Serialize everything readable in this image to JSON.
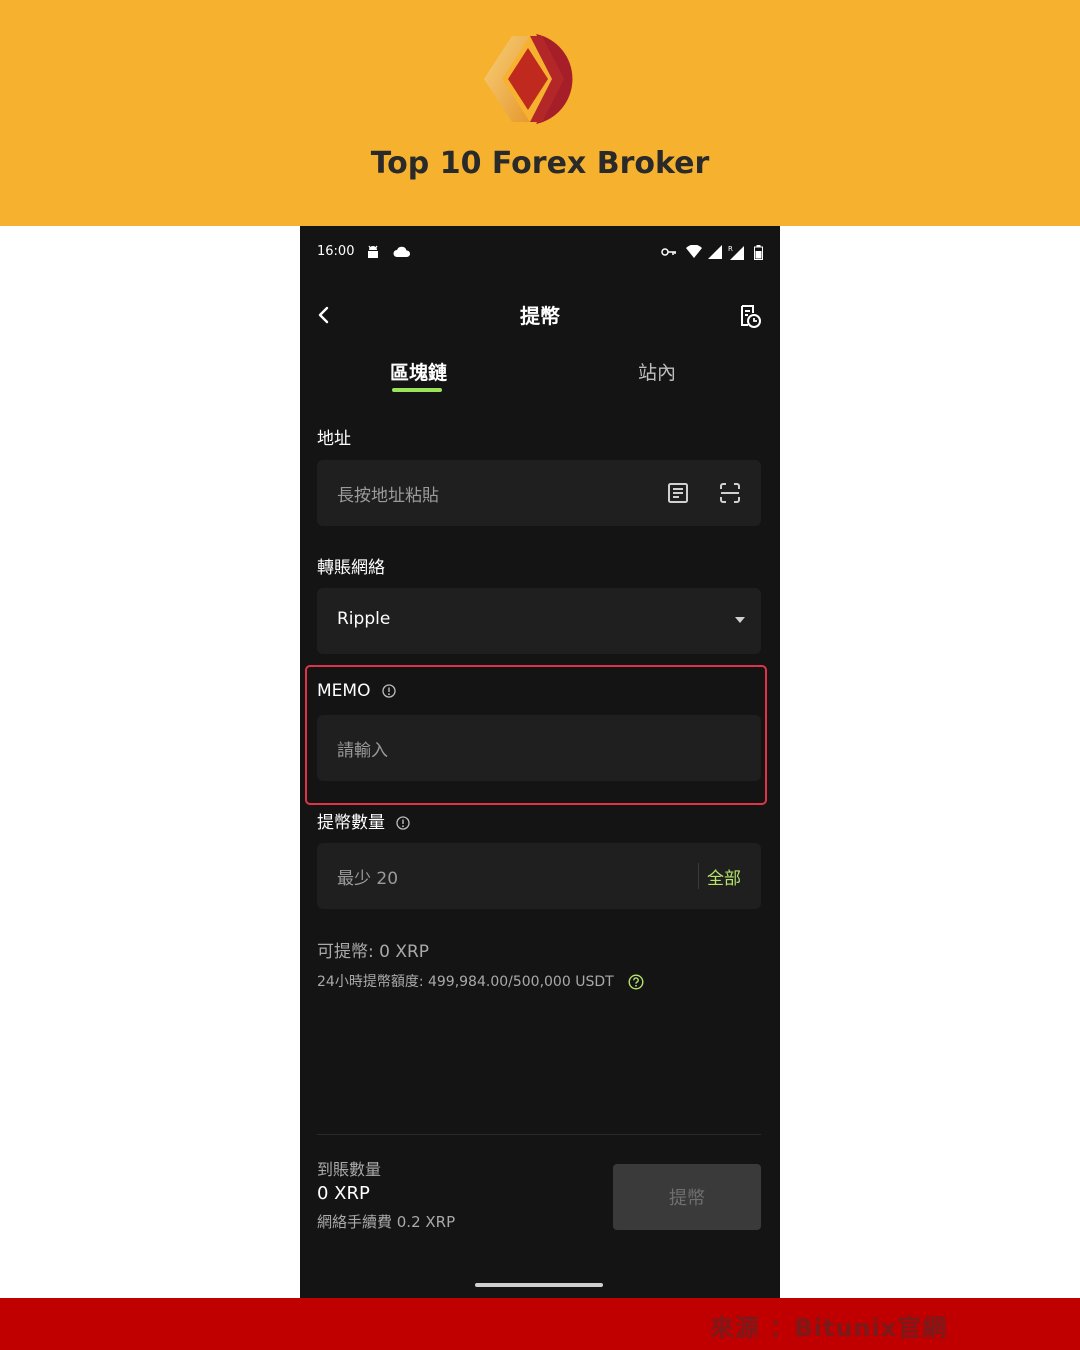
{
  "banner": {
    "title": "Top 10 Forex Broker",
    "background": "#f6b22f"
  },
  "status": {
    "time": "16:00",
    "left_icons": [
      "android-icon",
      "cloud-icon"
    ],
    "right_icons": [
      "vpn-key-icon",
      "wifi-icon",
      "signal-icon",
      "signal-roaming-icon",
      "battery-icon"
    ]
  },
  "nav": {
    "title": "提幣",
    "back_icon": "chevron-left-icon",
    "history_icon": "history-record-icon"
  },
  "tabs": [
    {
      "label": "區塊鏈",
      "active": true
    },
    {
      "label": "站內",
      "active": false
    }
  ],
  "address": {
    "label": "地址",
    "placeholder": "長按地址粘貼",
    "icons": [
      "address-book-icon",
      "scan-icon"
    ]
  },
  "network": {
    "label": "轉賬網絡",
    "value": "Ripple"
  },
  "memo": {
    "label": "MEMO",
    "placeholder": "請輸入"
  },
  "amount": {
    "label": "提幣數量",
    "placeholder": "最少 20",
    "all_label": "全部"
  },
  "available": "可提幣:  0  XRP",
  "limit": "24小時提幣額度:  499,984.00/500,000 USDT",
  "footer": {
    "receive_label": "到賬數量",
    "receive_value": "0 XRP",
    "fee": "網絡手續費   0.2 XRP",
    "submit_label": "提幣"
  },
  "source": "來源 ：Bitunix官網",
  "colors": {
    "accent": "#9be35a",
    "highlight": "#e0334a",
    "source_bar": "#c00000"
  }
}
